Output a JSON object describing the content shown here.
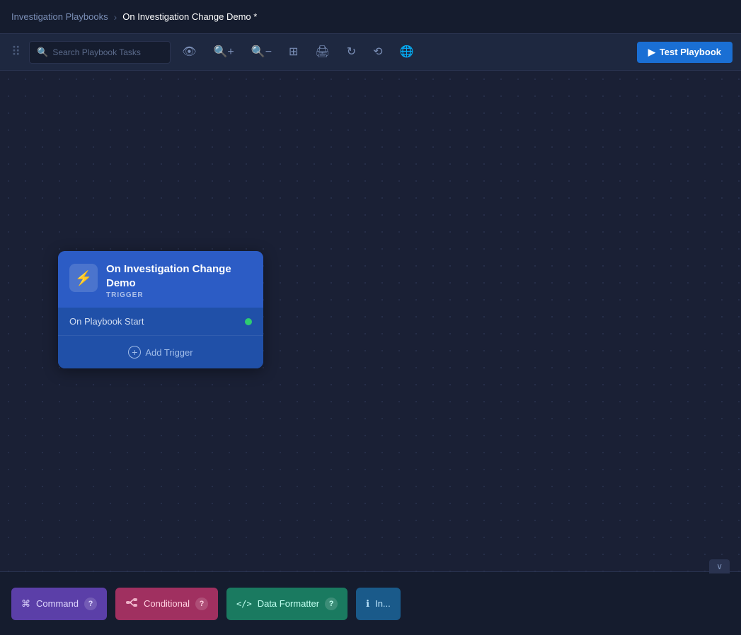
{
  "breadcrumb": {
    "parent_label": "Investigation Playbooks",
    "separator": "›",
    "current_label": "On Investigation Change Demo *"
  },
  "toolbar": {
    "search_placeholder": "Search Playbook Tasks",
    "test_playbook_label": "Test Playbook",
    "icon_play": "▶"
  },
  "trigger_node": {
    "icon": "⚡",
    "title": "On Investigation Change Demo",
    "subtitle": "TRIGGER",
    "row_label": "On Playbook Start",
    "add_trigger_label": "Add Trigger"
  },
  "bottom_palette": {
    "expand_icon": "∨",
    "items": [
      {
        "id": "command",
        "label": "Command",
        "icon": "⌘",
        "help": "?"
      },
      {
        "id": "conditional",
        "label": "Conditional",
        "icon": "⇒",
        "help": "?"
      },
      {
        "id": "data-formatter",
        "label": "Data Formatter",
        "icon": "</>",
        "help": "?"
      },
      {
        "id": "other",
        "label": "In...",
        "icon": "ℹ",
        "help": "?"
      }
    ]
  }
}
